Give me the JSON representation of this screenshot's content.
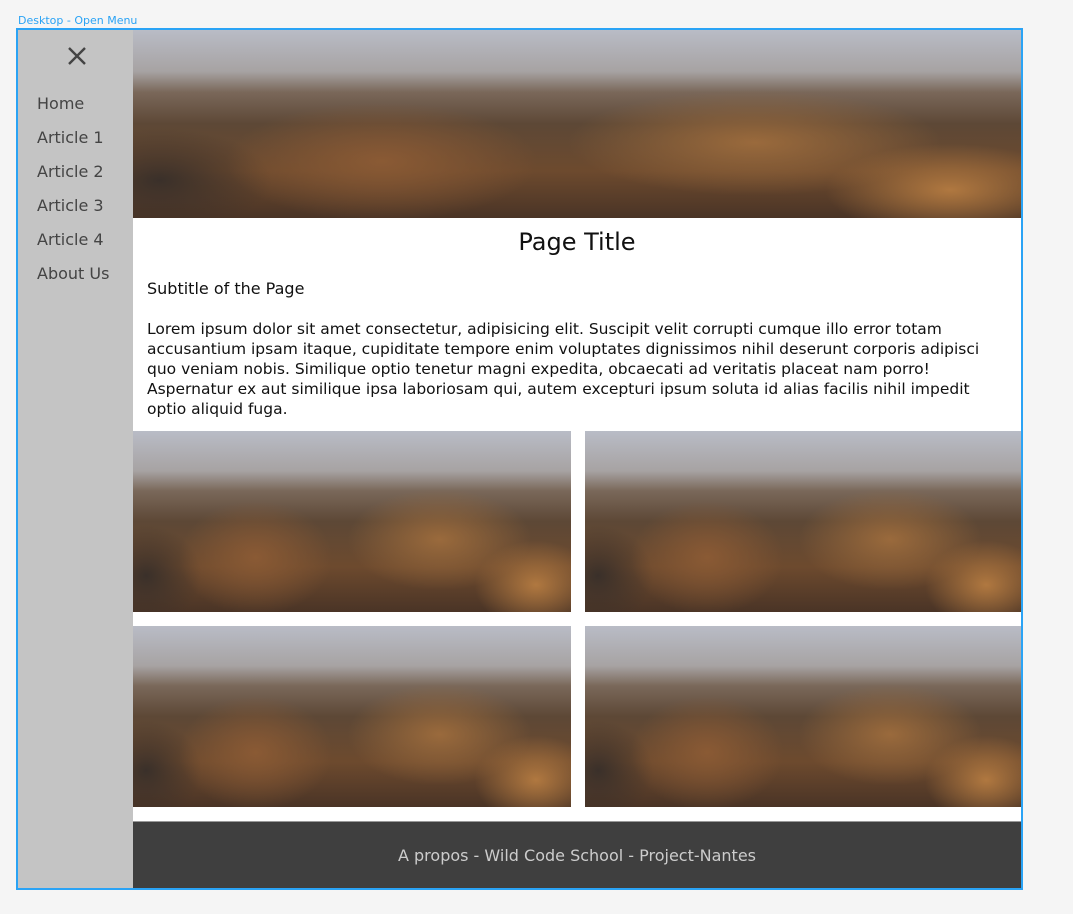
{
  "frame_label": "Desktop - Open Menu",
  "sidebar": {
    "close_icon": "close-icon",
    "items": [
      {
        "label": "Home"
      },
      {
        "label": "Article 1"
      },
      {
        "label": "Article 2"
      },
      {
        "label": "Article 3"
      },
      {
        "label": "Article 4"
      },
      {
        "label": "About Us"
      }
    ]
  },
  "main": {
    "title": "Page Title",
    "subtitle": "Subtitle of the Page",
    "body": "Lorem ipsum dolor sit amet consectetur, adipisicing elit. Suscipit velit corrupti cumque illo error totam accusantium ipsam itaque, cupiditate tempore enim voluptates dignissimos nihil deserunt corporis adipisci quo veniam nobis. Similique optio tenetur magni expedita, obcaecati ad veritatis placeat nam porro! Aspernatur ex aut similique ipsa laboriosam qui, autem excepturi ipsum soluta id alias facilis nihil impedit optio aliquid fuga."
  },
  "footer": {
    "text": "A propos - Wild Code School - Project-Nantes"
  },
  "colors": {
    "accent": "#2aa3f5",
    "sidebar": "#c4c4c4",
    "footer": "#3f3f3f"
  }
}
